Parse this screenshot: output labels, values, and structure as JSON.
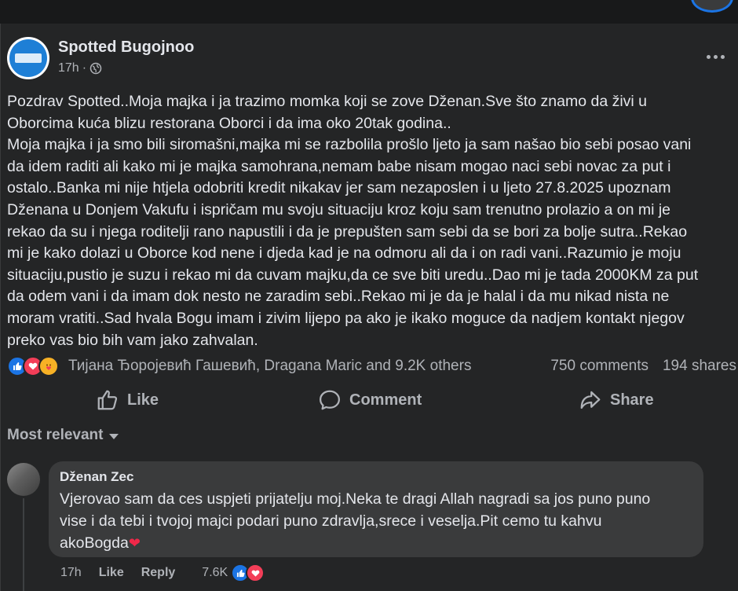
{
  "post": {
    "page_name": "Spotted Bugojnoo",
    "time": "17h",
    "text": "Pozdrav Spotted..Moja majka i ja trazimo momka koji se zove Dženan.Sve što znamo da živi u\nOborcima kuća blizu restorana Oborci i da ima oko 20tak godina..\nMoja majka i ja smo bili siromašni,majka mi se razbolila prošlo ljeto ja sam našao bio sebi posao vani\nda idem raditi ali kako mi je majka samohrana,nemam babe nisam mogao naci sebi novac za put i\nostalo..Banka mi nije htjela odobriti kredit nikakav jer sam nezaposlen i u ljeto 27.8.2025 upoznam\nDženana u Donjem Vakufu i ispričam mu svoju situaciju kroz koju sam trenutno prolazio a on mi je\nrekao da su i njega roditelji rano napustili i da je prepušten sam sebi da se bori za bolje sutra..Rekao\nmi je kako dolazi u Oborce kod nene i djeda kad je na odmoru ali da i on radi vani..Razumio je moju\nsituaciju,pustio je suzu i rekao mi da cuvam majku,da ce sve biti uredu..Dao mi je tada 2000KM za put\nda odem vani i da imam dok nesto ne zaradim sebi..Rekao mi je da je halal i da mu nikad nista ne\nmoram vratiti..Sad hvala Bogu imam i zivim lijepo pa ako je ikako moguce da nadjem kontakt njegov\npreko vas bio bih vam jako zahvalan.",
    "reactions_text": "Тијана Ђоројевић Гашевић, Dragana Maric and 9.2K others",
    "comments_count": "750 comments",
    "shares_count": "194 shares"
  },
  "actions": {
    "like": "Like",
    "comment": "Comment",
    "share": "Share"
  },
  "sort_label": "Most relevant",
  "comment": {
    "author": "Dženan Zec",
    "text": "Vjerovao sam da ces uspjeti prijatelju moj.Neka te dragi Allah nagradi sa jos puno puno\nvise i da tebi i tvojoj majci podari puno zdravlja,srece i veselja.Pit cemo tu kahvu\nakoBogda",
    "time": "17h",
    "like_label": "Like",
    "reply_label": "Reply",
    "reaction_count": "7.6K"
  },
  "colors": {
    "background": "#242526",
    "text": "#e4e6eb",
    "secondary_text": "#b0b3b8",
    "like_blue": "#1b74e4",
    "love_red": "#f33e58"
  }
}
